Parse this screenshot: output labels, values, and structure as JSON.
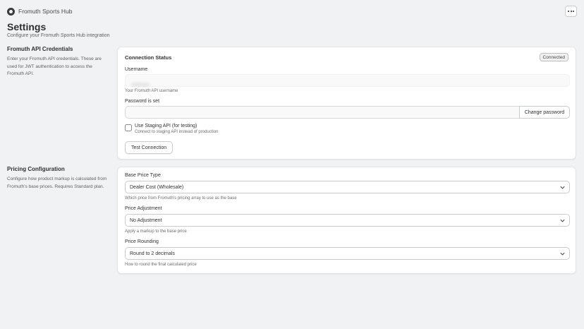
{
  "app": {
    "name": "Fromuth Sports Hub",
    "more_icon": "more-horizontal-icon"
  },
  "page": {
    "title": "Settings",
    "subtitle": "Configure your Fromuth Sports Hub integration"
  },
  "credentials": {
    "title": "Fromuth API Credentials",
    "description": "Enter your Fromuth API credentials. These are used for JWT authentication to access the Fromuth API.",
    "card_title": "Connection Status",
    "status_badge": "Connected",
    "username_label": "Username",
    "username_value": "rbekwim",
    "username_help": "Your Fromuth API username",
    "password_label": "Password is set",
    "password_value": "",
    "change_password_label": "Change password",
    "staging_label": "Use Staging API (for testing)",
    "staging_help": "Connect to staging API instead of production",
    "staging_checked": false,
    "test_connection_label": "Test Connection"
  },
  "pricing": {
    "title": "Pricing Configuration",
    "description": "Configure how product markup is calculated from Fromuth's base prices. Requires Standard plan.",
    "base_price_label": "Base Price Type",
    "base_price_value": "Dealer Cost (Wholesale)",
    "base_price_help": "Which price from Fromuth's pricing array to use as the base",
    "adjustment_label": "Price Adjustment",
    "adjustment_value": "No Adjustment",
    "adjustment_help": "Apply a markup to the base price",
    "rounding_label": "Price Rounding",
    "rounding_value": "Round to 2 decimals",
    "rounding_help": "How to round the final calculated price"
  },
  "colors": {
    "background": "#f1f2f4",
    "card": "#ffffff",
    "text": "#303030",
    "muted": "#616161"
  }
}
